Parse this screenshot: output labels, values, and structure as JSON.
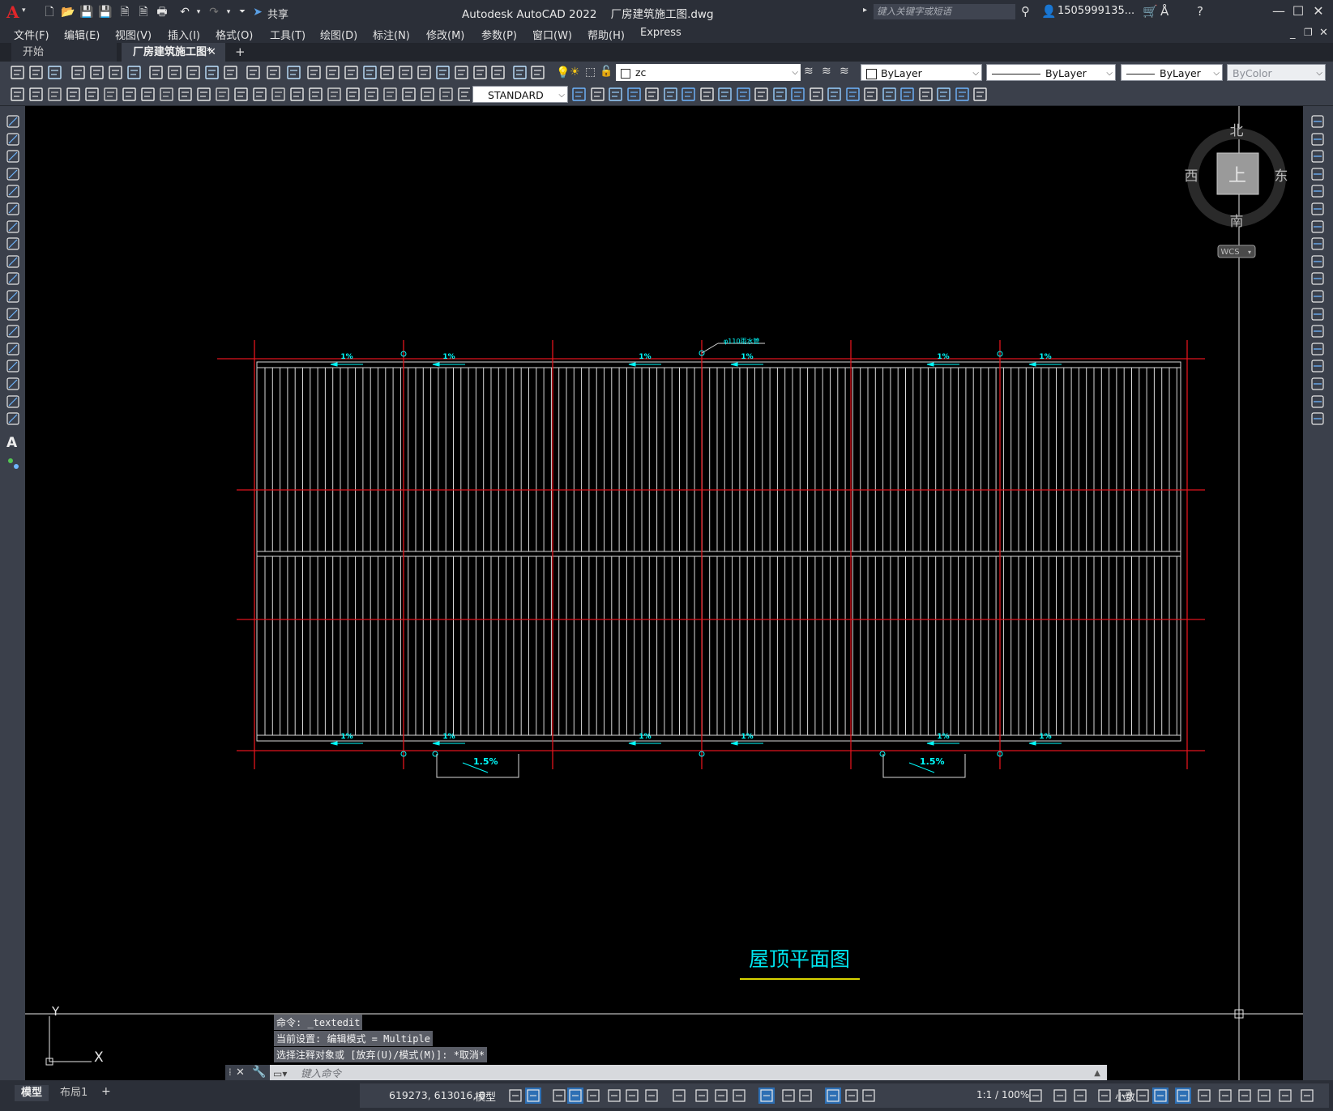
{
  "app": {
    "title": "Autodesk AutoCAD 2022    厂房建筑施工图.dwg",
    "logo": "A",
    "share_label": "共享",
    "search_placeholder": "键入关键字或短语",
    "user": "1505999135..."
  },
  "menu": [
    "文件(F)",
    "编辑(E)",
    "视图(V)",
    "插入(I)",
    "格式(O)",
    "工具(T)",
    "绘图(D)",
    "标注(N)",
    "修改(M)",
    "参数(P)",
    "窗口(W)",
    "帮助(H)",
    "Express"
  ],
  "tabs": {
    "start": "开始",
    "drawing": "厂房建筑施工图*",
    "close": "✕",
    "new": "+"
  },
  "toolbar": {
    "layer": "zc",
    "color": "ByLayer",
    "linetype": "ByLayer",
    "lineweight": "ByLayer",
    "plotstyle": "ByColor",
    "textstyle": "STANDARD"
  },
  "viewcube": {
    "north": "北",
    "south": "南",
    "east": "东",
    "west": "西",
    "face": "上",
    "ucs": "WCS"
  },
  "drawing": {
    "title": "屋顶平面图",
    "slope_labels": [
      "1%",
      "1%",
      "1%",
      "1%",
      "1%",
      "1%"
    ],
    "gutter_slope": "1.5%",
    "pipe_label": "φ110雨水管",
    "ucs_x": "X",
    "ucs_y": "Y"
  },
  "command": {
    "history": [
      "命令: _textedit",
      "当前设置: 编辑模式 = Multiple",
      "选择注释对象或 [放弃(U)/模式(M)]: *取消*"
    ],
    "placeholder": "键入命令"
  },
  "status": {
    "model_tab": "模型",
    "layout_tab": "布局1",
    "add_layout": "+",
    "coords": "619273, 613016, 0",
    "space": "模型",
    "scale": "1:1 / 100%",
    "units": "小数"
  },
  "colors": {
    "axis_red": "#e0141c",
    "drawing_line": "#d8d8d8",
    "annotation_cyan": "#00ffff",
    "title_underline": "#d8d400",
    "accent_blue": "#2d6fb4"
  }
}
